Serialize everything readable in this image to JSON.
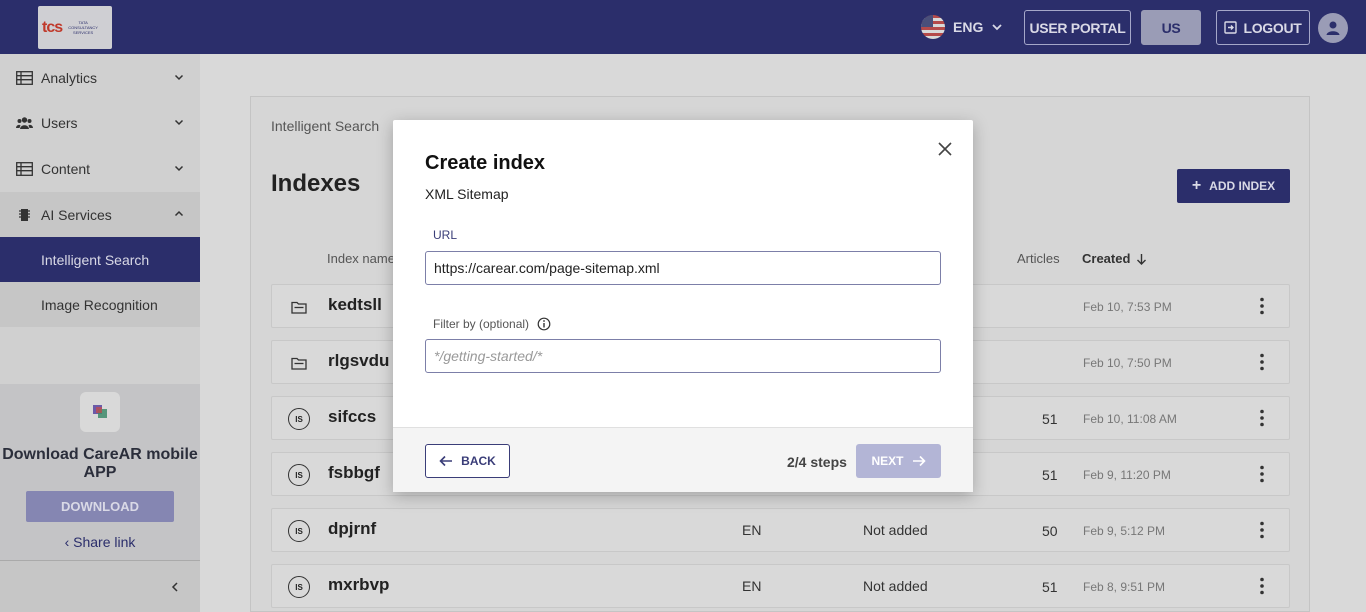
{
  "header": {
    "logo_text": "tcs",
    "logo_subtext": "TATA CONSULTANCY SERVICES",
    "language": "ENG",
    "user_portal_label": "USER PORTAL",
    "region_label": "US",
    "logout_label": "LOGOUT"
  },
  "sidebar": {
    "items": [
      {
        "label": "Analytics"
      },
      {
        "label": "Users"
      },
      {
        "label": "Content"
      },
      {
        "label": "AI Services"
      },
      {
        "label": "Intelligent Search"
      },
      {
        "label": "Image Recognition"
      }
    ],
    "promo_title": "Download CareAR mobile APP",
    "download_label": "DOWNLOAD",
    "share_label": "Share link"
  },
  "main": {
    "breadcrumb": "Intelligent Search",
    "title": "Indexes",
    "add_label": "ADD INDEX",
    "columns": {
      "name": "Index name",
      "articles": "Articles",
      "created": "Created"
    },
    "rows": [
      {
        "name": "kedtsll",
        "icon": "folder-icon",
        "lang": "",
        "status": "",
        "articles": "",
        "created": "Feb 10, 7:53 PM"
      },
      {
        "name": "rlgsvdu",
        "icon": "folder-icon",
        "lang": "",
        "status": "",
        "articles": "",
        "created": "Feb 10, 7:50 PM"
      },
      {
        "name": "sifccs",
        "icon": "is-icon",
        "lang": "",
        "status": "",
        "articles": "51",
        "created": "Feb 10, 11:08 AM"
      },
      {
        "name": "fsbbgf",
        "icon": "is-icon",
        "lang": "",
        "status": "",
        "articles": "51",
        "created": "Feb 9, 11:20 PM"
      },
      {
        "name": "dpjrnf",
        "icon": "is-icon",
        "lang": "EN",
        "status": "Not added",
        "articles": "50",
        "created": "Feb 9, 5:12 PM"
      },
      {
        "name": "mxrbvp",
        "icon": "is-icon",
        "lang": "EN",
        "status": "Not added",
        "articles": "51",
        "created": "Feb 8, 9:51 PM"
      }
    ],
    "is_badge": "IS"
  },
  "modal": {
    "title": "Create index",
    "subtitle": "XML Sitemap",
    "url_label": "URL",
    "url_value": "https://carear.com/page-sitemap.xml",
    "filter_label": "Filter by (optional)",
    "filter_placeholder": "*/getting-started/*",
    "back_label": "BACK",
    "steps": "2/4 steps",
    "next_label": "NEXT"
  },
  "colors": {
    "brand": "#2b2e6b",
    "accent_disabled": "#b3b5d6"
  }
}
